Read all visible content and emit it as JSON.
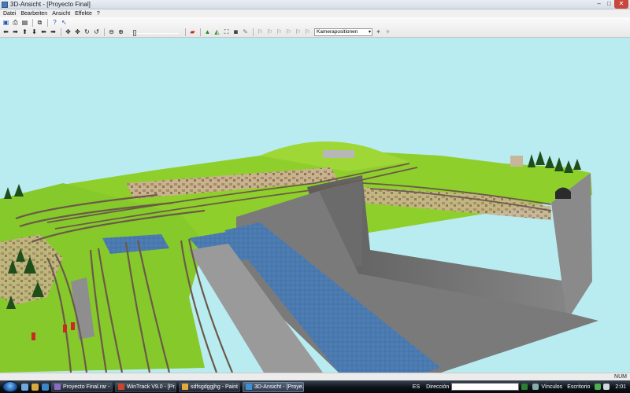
{
  "window": {
    "title": "3D-Ansicht - [Proyecto Final]",
    "buttons": {
      "minimize": "–",
      "maximize": "□",
      "close": "✕"
    }
  },
  "menu": {
    "items": [
      "Datei",
      "Bearbeiten",
      "Ansicht",
      "Effekte",
      "?"
    ]
  },
  "toolbar": {
    "row1_icons": [
      "save-icon",
      "print-icon",
      "print-preview-icon",
      "copy-icon",
      "help-icon",
      "context-help-icon"
    ],
    "row2_icons": [
      "arrow-left-icon",
      "arrow-right-icon",
      "arrow-up-icon",
      "arrow-down-icon",
      "rotate-left-icon",
      "rotate-right-icon",
      "walk-icon",
      "walk-back-icon",
      "tilt-up-icon",
      "tilt-down-icon",
      "zoom-out-icon",
      "zoom-in-icon",
      "train-red-icon",
      "landscape-icon",
      "terrain-icon",
      "fit-view-icon",
      "camera-icon",
      "paint-icon",
      "signal-icon",
      "signal-2-icon",
      "signal-3-icon",
      "signal-4-icon",
      "signal-5-icon",
      "signal-6-icon"
    ],
    "camera_dropdown": {
      "value": "Kamerapositionen",
      "arrow": "▾"
    }
  },
  "statusbar": {
    "num": "NUM"
  },
  "taskbar": {
    "tasks": [
      {
        "label": "Proyecto Final.rar - ...",
        "icon_color": "#8b6cc4"
      },
      {
        "label": "WinTrack V9.0 - [Pr...",
        "icon_color": "#c8472b"
      },
      {
        "label": "sdfsgdggjhg - Paint",
        "icon_color": "#e2a93b"
      },
      {
        "label": "3D-Ansicht - [Proye...",
        "icon_color": "#3f8fd2",
        "active": true
      }
    ],
    "tray": {
      "language": "ES",
      "address_label": "Dirección",
      "links_label": "Vínculos",
      "desktop_label": "Escritorio",
      "clock": "2:01"
    }
  },
  "colors": {
    "sky": "#b9ecf1",
    "grass": "#8fcf2b",
    "wall": "#707070",
    "water": "#4f7fb5",
    "track": "#6b5a4a"
  }
}
